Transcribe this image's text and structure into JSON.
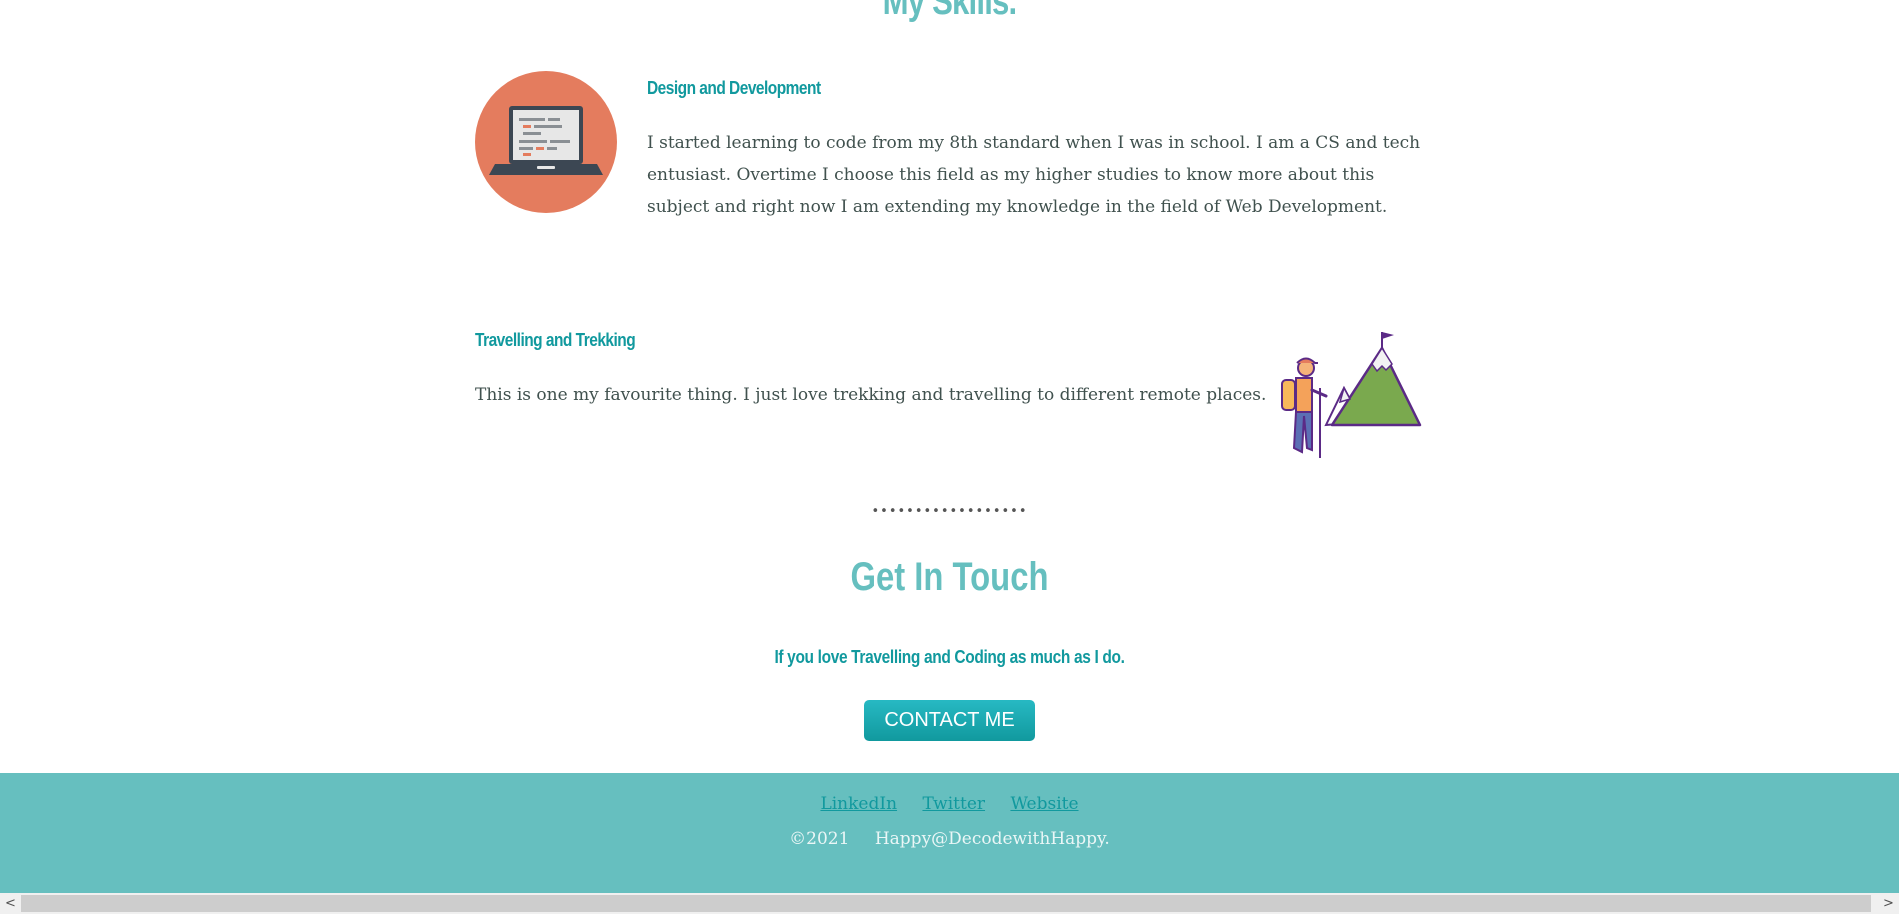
{
  "skills": {
    "title": "My Skills.",
    "design": {
      "heading": "Design and Development",
      "text": "I started learning to code from my 8th standard when I was in school. I am a CS and tech entusiast. Overtime I choose this field as my higher studies to know more about this subject and right now I am extending my knowledge in the field of Web Development.",
      "icon": "laptop-icon"
    },
    "travel": {
      "heading": "Travelling and Trekking",
      "text": "This is one my favourite thing. I just love trekking and travelling to different remote places.",
      "icon": "hiker-mountain-icon"
    }
  },
  "divider": "••••••••••••••••••",
  "contact": {
    "title": "Get In Touch",
    "subtitle": "If you love Travelling and Coding as much as I do.",
    "button_label": "CONTACT ME"
  },
  "footer": {
    "links": [
      "LinkedIn",
      "Twitter",
      "Website"
    ],
    "copyright_year": "©2021",
    "copyright_name": "Happy@DecodewithHappy."
  },
  "scrollbar": {
    "left_arrow": "<",
    "right_arrow": ">"
  },
  "colors": {
    "accent": "#66bfbf",
    "heading": "#11999e",
    "circle": "#e47c5e",
    "text": "#40514e"
  }
}
